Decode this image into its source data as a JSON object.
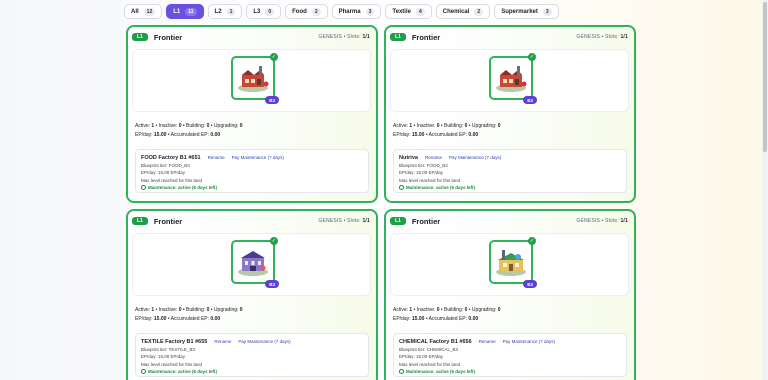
{
  "tabs": [
    {
      "label": "All",
      "count": "12",
      "active": false
    },
    {
      "label": "L1",
      "count": "11",
      "active": true
    },
    {
      "label": "L2",
      "count": "1",
      "active": false
    },
    {
      "label": "L3",
      "count": "0",
      "active": false
    },
    {
      "label": "Food",
      "count": "2",
      "active": false
    },
    {
      "label": "Pharma",
      "count": "3",
      "active": false
    },
    {
      "label": "Textile",
      "count": "4",
      "active": false
    },
    {
      "label": "Chemical",
      "count": "2",
      "active": false
    },
    {
      "label": "Supermarket",
      "count": "3",
      "active": false
    }
  ],
  "cards": [
    {
      "level": "L1",
      "title": "Frontier",
      "genesis_label": "GENESIS • Slots:",
      "slots": "1/1",
      "tier_badge": "B3",
      "building_icon": "factory-icon",
      "stats_line1": {
        "active_label": "Active:",
        "active": "1",
        "inactive_label": "• Inactive:",
        "inactive": "0",
        "building_label": "• Building:",
        "building": "0",
        "upgrading_label": "• Upgrading:",
        "upgrading": "0"
      },
      "stats_line2": {
        "epday_label": "EP/day:",
        "epday": "15.00",
        "acc_label": "• Accumulated EP:",
        "acc": "0.00"
      },
      "building": {
        "name": "FOOD Factory B1 #651",
        "rename": "Rename",
        "pay": "Pay Maintenance (7 days)",
        "blueprint": "Blueprint tier: FOOD_B3",
        "epday": "EP/day: 15.00 EP/day",
        "max_level": "Max level reached for this land",
        "maintenance": "Maintenance: active (6 days left)"
      }
    },
    {
      "level": "L1",
      "title": "Frontier",
      "genesis_label": "GENESIS • Slots:",
      "slots": "1/1",
      "tier_badge": "B3",
      "building_icon": "factory-icon",
      "stats_line1": {
        "active_label": "Active:",
        "active": "1",
        "inactive_label": "• Inactive:",
        "inactive": "0",
        "building_label": "• Building:",
        "building": "0",
        "upgrading_label": "• Upgrading:",
        "upgrading": "0"
      },
      "stats_line2": {
        "epday_label": "EP/day:",
        "epday": "15.00",
        "acc_label": "• Accumulated EP:",
        "acc": "0.00"
      },
      "building": {
        "name": "Nutriva",
        "rename": "Rename",
        "pay": "Pay Maintenance (7 days)",
        "blueprint": "Blueprint tier: FOOD_B3",
        "epday": "EP/day: 15.00 EP/day",
        "max_level": "Max level reached for this land",
        "maintenance": "Maintenance: active (6 days left)"
      }
    },
    {
      "level": "L1",
      "title": "Frontier",
      "genesis_label": "GENESIS • Slots:",
      "slots": "1/1",
      "tier_badge": "B3",
      "building_icon": "textile-mill-icon",
      "stats_line1": {
        "active_label": "Active:",
        "active": "1",
        "inactive_label": "• Inactive:",
        "inactive": "0",
        "building_label": "• Building:",
        "building": "0",
        "upgrading_label": "• Upgrading:",
        "upgrading": "0"
      },
      "stats_line2": {
        "epday_label": "EP/day:",
        "epday": "15.00",
        "acc_label": "• Accumulated EP:",
        "acc": "0.00"
      },
      "building": {
        "name": "TEXTILE Factory B1 #655",
        "rename": "Rename",
        "pay": "Pay Maintenance (7 days)",
        "blueprint": "Blueprint tier: TEXTILE_B3",
        "epday": "EP/day: 15.00 EP/day",
        "max_level": "Max level reached for this land",
        "maintenance": "Maintenance: active (6 days left)"
      }
    },
    {
      "level": "L1",
      "title": "Frontier",
      "genesis_label": "GENESIS • Slots:",
      "slots": "1/1",
      "tier_badge": "B3",
      "building_icon": "chemical-plant-icon",
      "stats_line1": {
        "active_label": "Active:",
        "active": "1",
        "inactive_label": "• Inactive:",
        "inactive": "0",
        "building_label": "• Building:",
        "building": "0",
        "upgrading_label": "• Upgrading:",
        "upgrading": "0"
      },
      "stats_line2": {
        "epday_label": "EP/day:",
        "epday": "15.00",
        "acc_label": "• Accumulated EP:",
        "acc": "0.00"
      },
      "building": {
        "name": "CHEMICAL Factory B1 #656",
        "rename": "Rename",
        "pay": "Pay Maintenance (7 days)",
        "blueprint": "Blueprint tier: CHEMICAL_B3",
        "epday": "EP/day: 15.00 EP/day",
        "max_level": "Max level reached for this land",
        "maintenance": "Maintenance: active (6 days left)"
      }
    }
  ],
  "colors": {
    "accent": "#6b4fe0",
    "card_border": "#2eb35a",
    "level_badge": "#1f9e4a",
    "tier_badge": "#5b3fd6",
    "link": "#2f3fa6"
  }
}
